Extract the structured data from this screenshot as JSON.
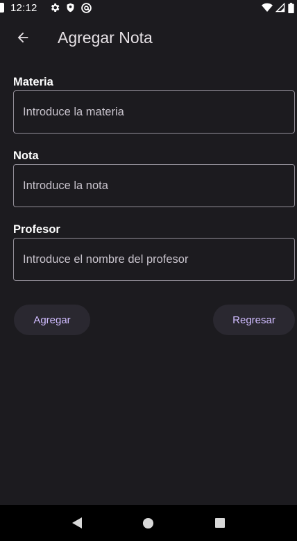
{
  "status_bar": {
    "time": "12:12",
    "icons": [
      "gear-icon",
      "shield-icon",
      "at-sign-icon",
      "wifi-icon",
      "signal-icon",
      "battery-icon"
    ]
  },
  "app_bar": {
    "title": "Agregar Nota",
    "back_icon": "arrow-back-icon"
  },
  "form": {
    "fields": [
      {
        "label": "Materia",
        "placeholder": "Introduce la materia",
        "value": ""
      },
      {
        "label": "Nota",
        "placeholder": "Introduce la nota",
        "value": ""
      },
      {
        "label": "Profesor",
        "placeholder": "Introduce el nombre del profesor",
        "value": ""
      }
    ]
  },
  "actions": {
    "add_label": "Agregar",
    "back_label": "Regresar"
  },
  "nav_bar": {
    "icons": [
      "nav-back-icon",
      "nav-home-icon",
      "nav-recents-icon"
    ]
  },
  "colors": {
    "background": "#1c1b1f",
    "accent": "#d0bcff",
    "button_bg": "#2a2830",
    "outline": "#938f99"
  }
}
